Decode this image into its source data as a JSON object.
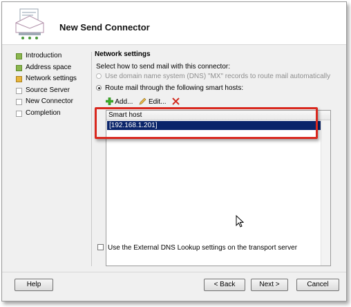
{
  "header": {
    "title": "New Send Connector"
  },
  "nav": {
    "items": [
      {
        "label": "Introduction",
        "state": "done"
      },
      {
        "label": "Address space",
        "state": "done"
      },
      {
        "label": "Network settings",
        "state": "current"
      },
      {
        "label": "Source Server",
        "state": "pending"
      },
      {
        "label": "New Connector",
        "state": "pending"
      },
      {
        "label": "Completion",
        "state": "pending"
      }
    ]
  },
  "content": {
    "section_title": "Network settings",
    "instruction": "Select how to send mail with this connector:",
    "radio_dns": "Use domain name system (DNS) \"MX\" records to route mail automatically",
    "radio_smart": "Route mail through the following smart hosts:",
    "toolbar": {
      "add": "Add...",
      "edit": "Edit..."
    },
    "list": {
      "header": "Smart host",
      "rows": [
        "[192.168.1.201]"
      ]
    },
    "checkbox_label": "Use the External DNS Lookup settings on the transport server"
  },
  "footer": {
    "help": "Help",
    "back": "< Back",
    "next": "Next >",
    "cancel": "Cancel"
  },
  "colors": {
    "accent_highlight": "#d9281e",
    "selection": "#0a246a",
    "done": "#8bb74e",
    "current": "#e8b53b"
  }
}
